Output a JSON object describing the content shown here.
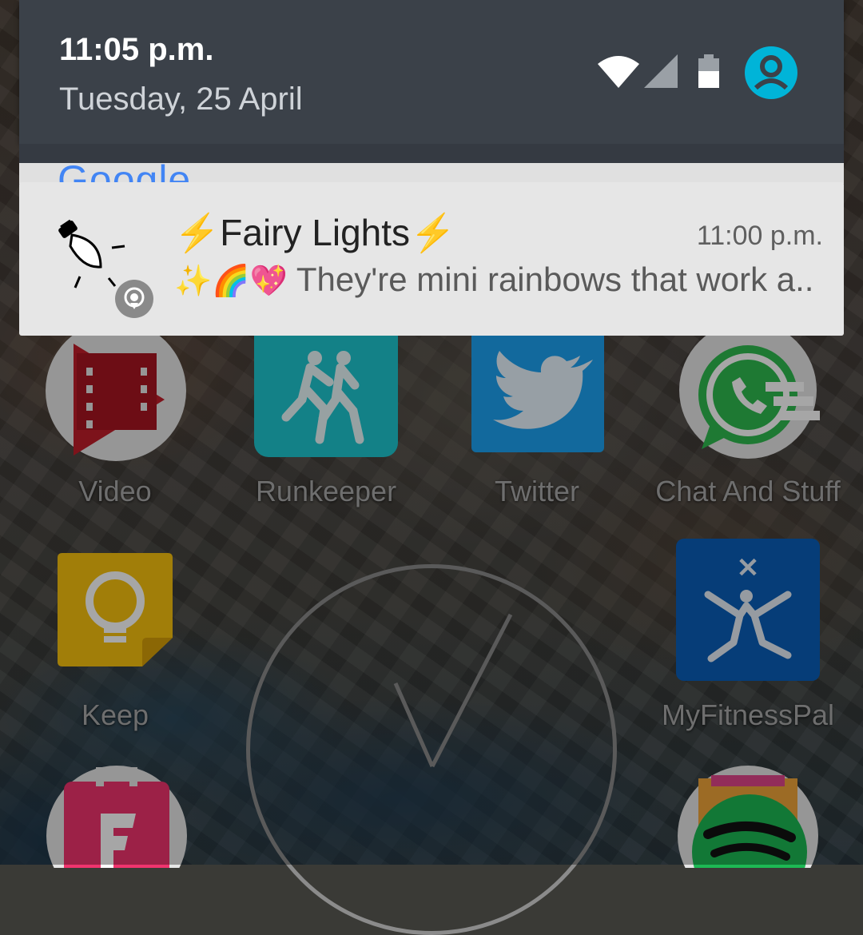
{
  "status": {
    "time": "11:05 p.m.",
    "date": "Tuesday, 25 April",
    "icons": [
      "wifi-icon",
      "signal-icon",
      "battery-icon",
      "user-account-icon"
    ],
    "accent_color": "#00b4d8"
  },
  "notification": {
    "app_icon": "fairy-light-bulb-icon",
    "badge_icon": "notification-source-icon",
    "title_prefix": "⚡",
    "title": "Fairy Lights",
    "title_suffix": "⚡",
    "time": "11:00 p.m.",
    "body_emoji": "✨🌈💖",
    "body": "They're mini rainbows that work a.."
  },
  "google_peek": "Google",
  "apps": [
    {
      "label": "Video",
      "icon": "play-movies-icon"
    },
    {
      "label": "Runkeeper",
      "icon": "runkeeper-icon"
    },
    {
      "label": "Twitter",
      "icon": "twitter-bird-icon"
    },
    {
      "label": "Chat And Stuff",
      "icon": "whatsapp-icon"
    },
    {
      "label": "Keep",
      "icon": "keep-lightbulb-icon"
    },
    {
      "label": "MyFitnessPal",
      "icon": "myfitnesspal-icon"
    }
  ],
  "bottom_apps": [
    "foursquare-icon",
    "spotify-icon"
  ],
  "widget": "clock-widget"
}
